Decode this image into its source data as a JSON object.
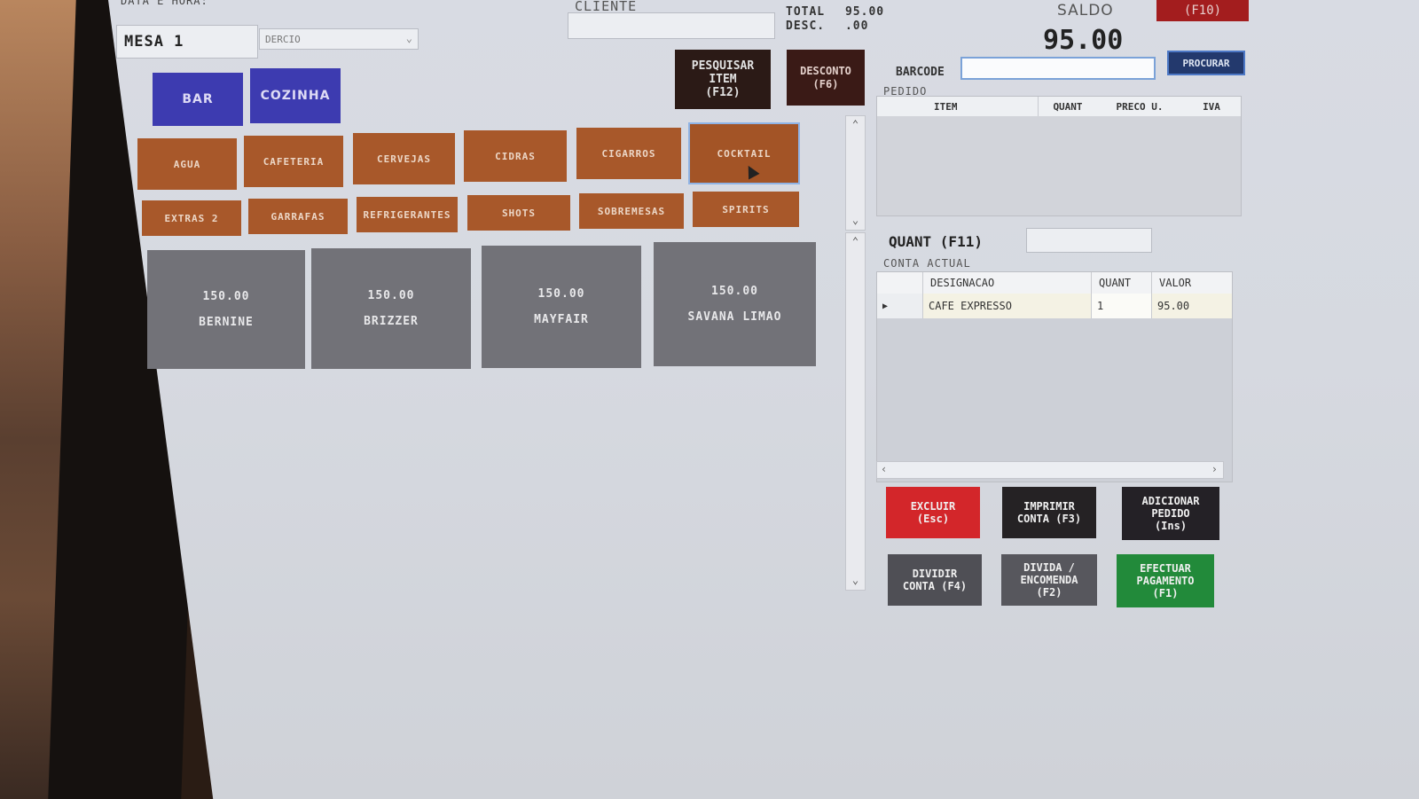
{
  "header": {
    "date_label": "DATA E HORA:",
    "table_name": "MESA 1",
    "waiter": "DERCIO",
    "cliente_label": "CLIENTE",
    "total_label": "TOTAL",
    "total_value": "95.00",
    "desc_label": "DESC.",
    "desc_value": ".00",
    "saldo_label": "SALDO",
    "saldo_value": "95.00",
    "f10_label": "(F10)"
  },
  "toolbar": {
    "pesquisar_label": "PESQUISAR\nITEM\n(F12)",
    "desconto_label": "DESCONTO\n(F6)",
    "barcode_label": "BARCODE",
    "procurar_label": "PROCURAR"
  },
  "departments": [
    "BAR",
    "COZINHA"
  ],
  "categories": {
    "row1": [
      "AGUA",
      "CAFETERIA",
      "CERVEJAS",
      "CIDRAS",
      "CIGARROS",
      "COCKTAIL"
    ],
    "row2": [
      "EXTRAS 2",
      "GARRAFAS",
      "REFRIGERANTES",
      "SHOTS",
      "SOBREMESAS",
      "SPIRITS"
    ],
    "selected": "COCKTAIL"
  },
  "products": [
    {
      "price": "150.00",
      "name": "BERNINE"
    },
    {
      "price": "150.00",
      "name": "BRIZZER"
    },
    {
      "price": "150.00",
      "name": "MAYFAIR"
    },
    {
      "price": "150.00",
      "name": "SAVANA LIMAO"
    }
  ],
  "pedido": {
    "title": "PEDIDO",
    "columns": [
      "ITEM",
      "QUANT",
      "PRECO U.",
      "IVA"
    ]
  },
  "quant": {
    "label": "QUANT (F11)"
  },
  "conta": {
    "title": "CONTA ACTUAL",
    "columns": [
      "DESIGNACAO",
      "QUANT",
      "VALOR"
    ],
    "rows": [
      {
        "designacao": "CAFE EXPRESSO",
        "quant": "1",
        "valor": "95.00"
      }
    ]
  },
  "actions": {
    "excluir": "EXCLUIR\n(Esc)",
    "imprimir": "IMPRIMIR\nCONTA (F3)",
    "adicionar": "ADICIONAR\nPEDIDO\n(Ins)",
    "dividir": "DIVIDIR\nCONTA (F4)",
    "divida": "DIVIDA /\nENCOMENDA\n(F2)",
    "efectuar": "EFECTUAR\nPAGAMENTO\n(F1)"
  },
  "colors": {
    "category": "#a8582a",
    "department": "#3d3bb0",
    "product": "#727278",
    "excluir": "#d3262a",
    "efectuar": "#228a3a",
    "dark_button": "#262326"
  }
}
